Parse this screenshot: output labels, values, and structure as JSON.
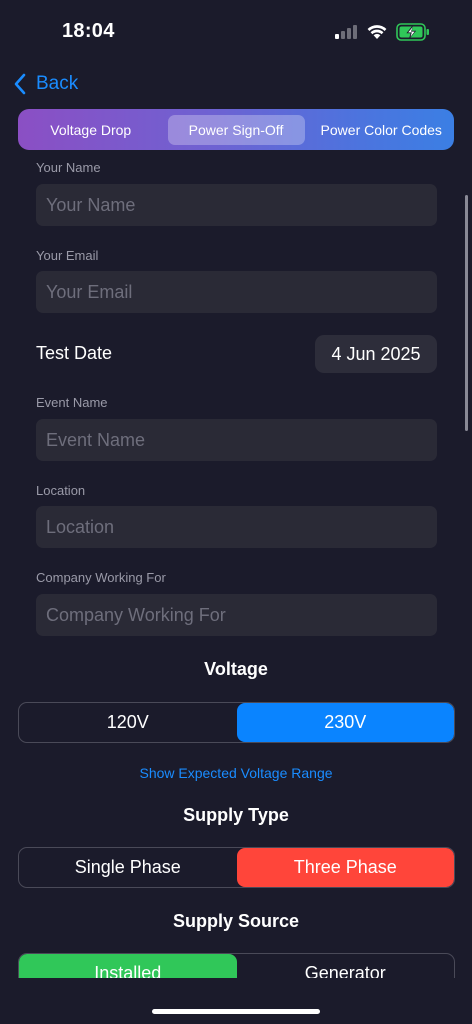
{
  "status_bar": {
    "time": "18:04"
  },
  "nav": {
    "back_label": "Back"
  },
  "top_tabs": [
    {
      "label": "Voltage Drop"
    },
    {
      "label": "Power Sign-Off"
    },
    {
      "label": "Power Color Codes"
    }
  ],
  "form": {
    "name": {
      "label": "Your Name",
      "placeholder": "Your Name",
      "value": ""
    },
    "email": {
      "label": "Your Email",
      "placeholder": "Your Email",
      "value": ""
    },
    "test_date": {
      "label": "Test Date",
      "value": "4 Jun 2025"
    },
    "event": {
      "label": "Event Name",
      "placeholder": "Event Name",
      "value": ""
    },
    "location": {
      "label": "Location",
      "placeholder": "Location",
      "value": ""
    },
    "company": {
      "label": "Company Working For",
      "placeholder": "Company Working For",
      "value": ""
    }
  },
  "voltage": {
    "title": "Voltage",
    "options": [
      "120V",
      "230V"
    ],
    "selected": "230V",
    "range_link": "Show Expected Voltage Range"
  },
  "supply_type": {
    "title": "Supply Type",
    "options": [
      "Single Phase",
      "Three Phase"
    ],
    "selected": "Three Phase"
  },
  "supply_source": {
    "title": "Supply Source",
    "options": [
      "Installed",
      "Generator"
    ],
    "selected": "Installed"
  },
  "colors": {
    "accent_blue": "#0a84ff",
    "accent_red": "#ff453a",
    "accent_green": "#30c759",
    "background": "#1b1b2b"
  }
}
